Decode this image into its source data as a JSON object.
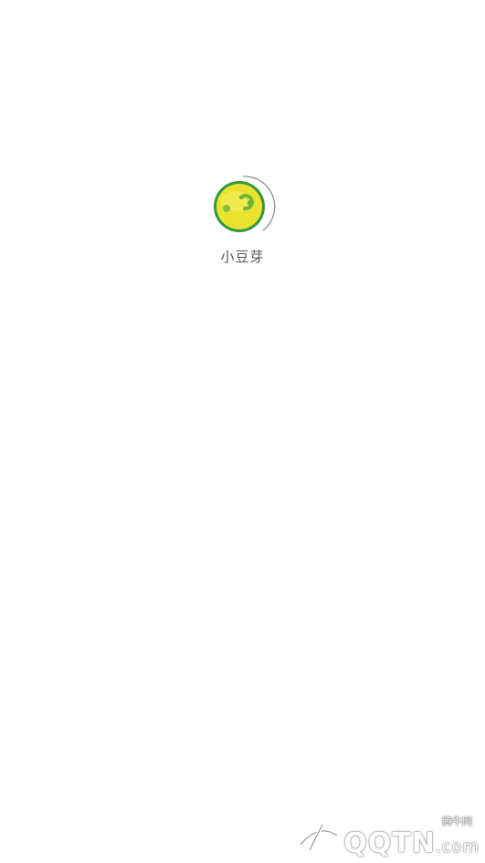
{
  "app": {
    "name": "小豆芽",
    "logo_icon": "bean-sprout-smiley-icon",
    "colors": {
      "background": "#ffffff",
      "logo_fill": "#e9e22f",
      "logo_ring": "#2e9a3c",
      "logo_accent": "#3fae45",
      "label": "#555555"
    }
  },
  "watermark": {
    "cn": "腾牛网",
    "en": "QQTN",
    "suffix": ".com"
  }
}
